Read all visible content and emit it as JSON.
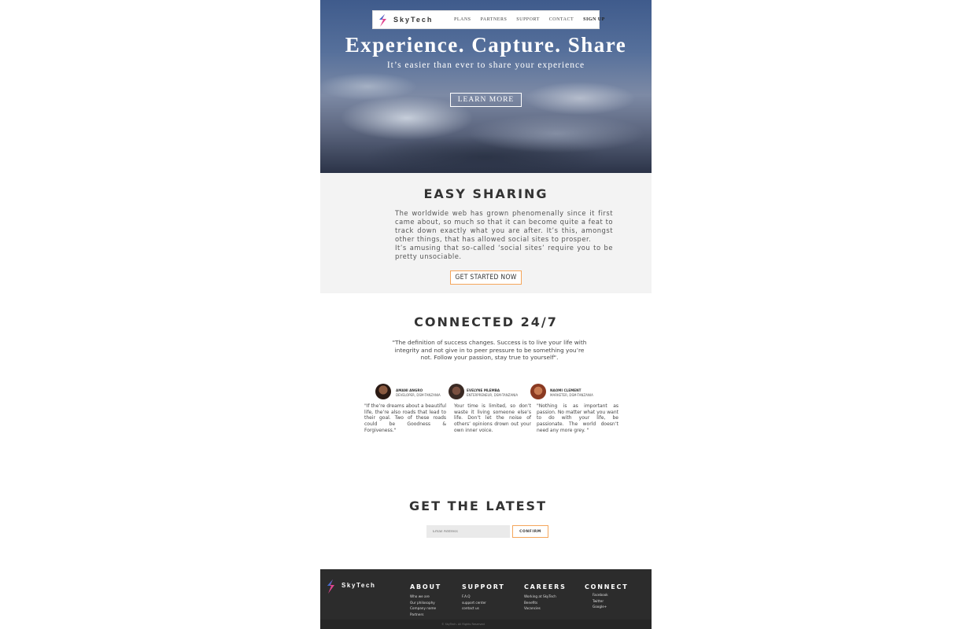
{
  "nav": {
    "brand": "SkyTech",
    "links": [
      "PLANS",
      "PARTNERS",
      "SUPPORT",
      "CONTACT"
    ],
    "signup": "SIGN UP"
  },
  "hero": {
    "title": "Experience. Capture. Share",
    "subtitle": "It’s easier than ever to share your experience",
    "button": "LEARN MORE"
  },
  "sharing": {
    "title": "EASY SHARING",
    "paragraph1": "The worldwide web has grown phenomenally since it first came about, so much so that it can become quite a feat to track down exactly what you are after. It’s this, amongst other things, that has allowed social sites to prosper.",
    "paragraph2": "It’s amusing that so-called ‘social sites’ require you to be pretty unsociable.",
    "button": "GET STARTED NOW"
  },
  "connected": {
    "title": "CONNECTED 24/7",
    "quote": "\"The definition of success changes. Success is to live your life with integrity and not give in to peer pressure to be something you’re not. Follow your passion, stay true to yourself\".",
    "testimonials": [
      {
        "name": "AMANI ANGRO",
        "role": "DEVELOPER, DSM-TANZANIA",
        "text": "\"If the’re dreams about a beautiful life, the’re also roads that lead to their goal. Two of these roads could be Goodness & Forgiveness.\"",
        "avatar_color": "#5a3a2a"
      },
      {
        "name": "EVELYNE MLEMBA",
        "role": "ENTERPRENEUR, DSM-TANZANIA",
        "text": "Your time is limited, so don’t waste it living someone else’s life. Don’t let the noise of others’ opinions drown out your own inner voice.",
        "avatar_color": "#3a2a24"
      },
      {
        "name": "NAOMI CLEMENT",
        "role": "MARKETER, DSM-TANZANIA",
        "text": "\"Nothing is as important as passion. No matter what you want to do with your life, be passionate. The world doesn’t need any more grey. \"",
        "avatar_color": "#b0603a"
      }
    ]
  },
  "latest": {
    "title": "GET THE LATEST",
    "email_placeholder": "Email Address",
    "button": "CONFIRM"
  },
  "footer": {
    "brand": "SkyTech",
    "columns": [
      {
        "title": "ABOUT",
        "links": [
          "Who we are",
          "Our philosophy",
          "Company name",
          "Partners"
        ]
      },
      {
        "title": "SUPPORT",
        "links": [
          "F.A.Q",
          "support center",
          "contact us"
        ]
      },
      {
        "title": "CAREERS",
        "links": [
          "Working at SkyTech",
          "Benefits",
          "Vacancies"
        ]
      },
      {
        "title": "CONNECT",
        "links": [
          "Facebook",
          "Twitter",
          "Google+"
        ]
      }
    ],
    "copyright": "© SkyTech. All Rights Reserved"
  },
  "colors": {
    "accent_orange": "#f5a65b",
    "footer_bg": "#2c2c2c",
    "section_gray": "#f3f3f3",
    "logo_pink": "#e0458f",
    "logo_blue": "#3b6fd1"
  }
}
